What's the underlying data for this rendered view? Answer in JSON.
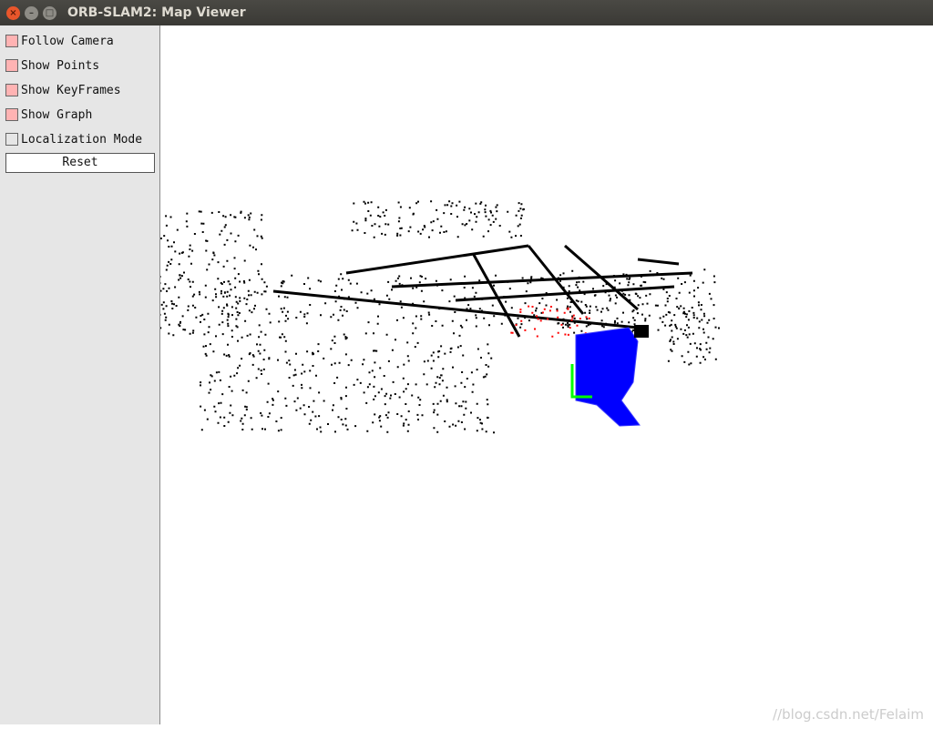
{
  "window": {
    "title": "ORB-SLAM2: Map Viewer",
    "controls": [
      "close",
      "minimize",
      "maximize"
    ]
  },
  "panel": {
    "options": [
      {
        "label": "Follow Camera",
        "checked": true
      },
      {
        "label": "Show Points",
        "checked": true
      },
      {
        "label": "Show KeyFrames",
        "checked": true
      },
      {
        "label": "Show Graph",
        "checked": true
      },
      {
        "label": "Localization Mode",
        "checked": false
      }
    ],
    "reset_label": "Reset"
  },
  "viewer": {
    "colors": {
      "map_points": "#000000",
      "reference_points": "#ff0000",
      "keyframes": "#0000ff",
      "graph": "#00ff00",
      "current_camera": "#00ff00"
    },
    "watermark": "//blog.csdn.net/Felaim"
  }
}
